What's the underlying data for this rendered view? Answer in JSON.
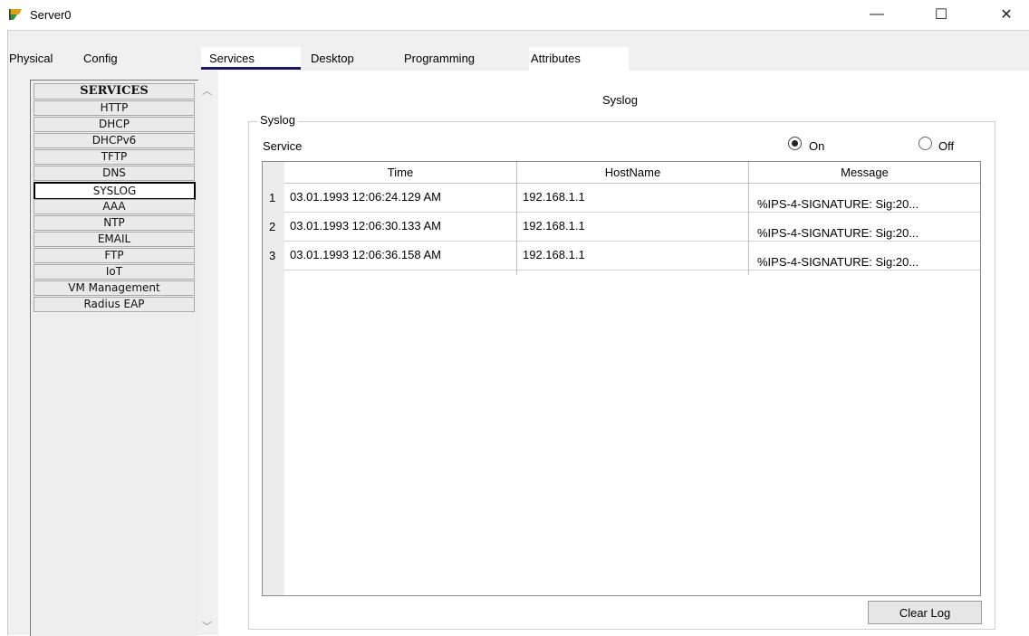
{
  "window": {
    "title": "Server0",
    "minimize_glyph": "—",
    "maximize_glyph": "☐",
    "close_glyph": "✕",
    "icon": "packet-tracer-server-icon"
  },
  "tabs": [
    {
      "label": "Physical"
    },
    {
      "label": "Config"
    },
    {
      "label": "Services",
      "active": true
    },
    {
      "label": "Desktop"
    },
    {
      "label": "Programming"
    },
    {
      "label": "Attributes"
    }
  ],
  "services": {
    "header": "SERVICES",
    "items": [
      "HTTP",
      "DHCP",
      "DHCPv6",
      "TFTP",
      "DNS",
      "SYSLOG",
      "AAA",
      "NTP",
      "EMAIL",
      "FTP",
      "IoT",
      "VM Management",
      "Radius EAP"
    ],
    "selected": "SYSLOG"
  },
  "syslog": {
    "panel_title": "Syslog",
    "group_label": "Syslog",
    "service_label": "Service",
    "on_label": "On",
    "off_label": "Off",
    "service_state": "On",
    "columns": [
      "Time",
      "HostName",
      "Message"
    ],
    "rows": [
      {
        "num": "1",
        "time": "03.01.1993 12:06:24.129 AM",
        "host": "192.168.1.1",
        "message": "%IPS-4-SIGNATURE: Sig:20..."
      },
      {
        "num": "2",
        "time": "03.01.1993 12:06:30.133 AM",
        "host": "192.168.1.1",
        "message": "%IPS-4-SIGNATURE: Sig:20..."
      },
      {
        "num": "3",
        "time": "03.01.1993 12:06:36.158 AM",
        "host": "192.168.1.1",
        "message": "%IPS-4-SIGNATURE: Sig:20..."
      }
    ],
    "clear_button": "Clear Log"
  }
}
